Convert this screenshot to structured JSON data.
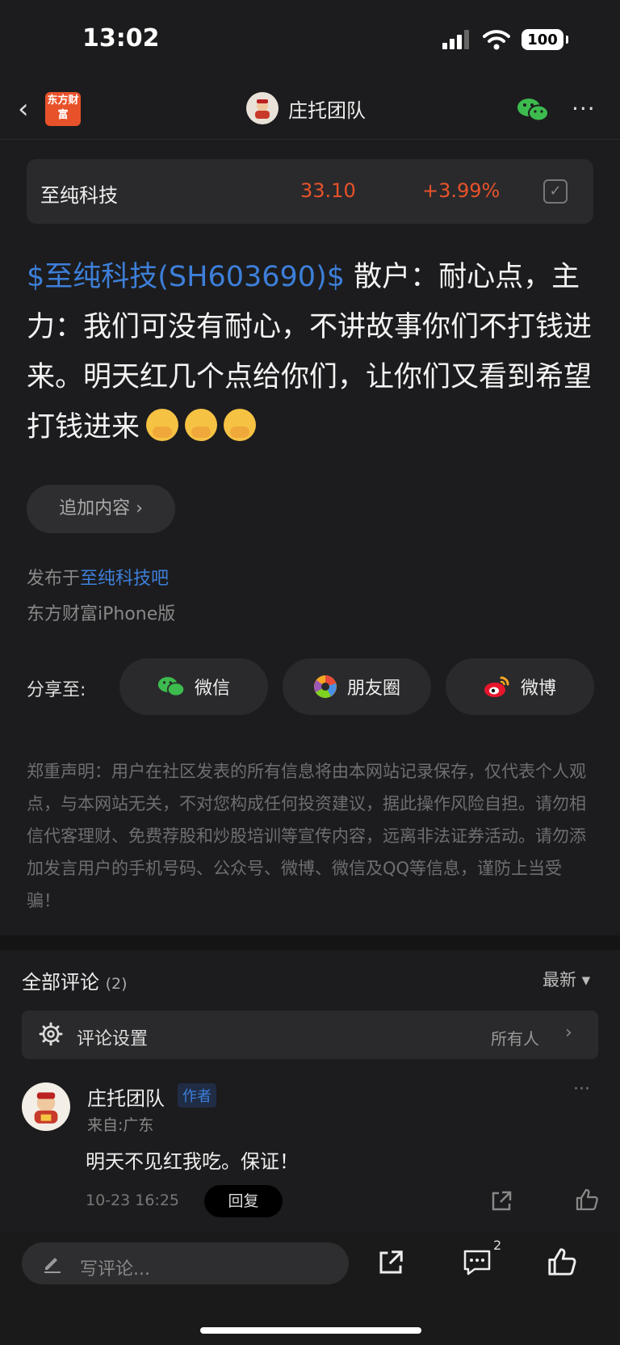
{
  "status_bar": {
    "time": "13:02",
    "battery": "100"
  },
  "nav": {
    "logo_text": "东方财富",
    "title": "庄托团队"
  },
  "stock": {
    "name": "至纯科技",
    "price": "33.10",
    "change": "+3.99%"
  },
  "post": {
    "tag": "$至纯科技(SH603690)$",
    "body": " 散户：耐心点，主力：我们可没有耐心，不讲故事你们不打钱进来。明天红几个点给你们，让你们又看到希望打钱进来"
  },
  "add_content": "追加内容 ›",
  "meta": {
    "published_prefix": "发布于",
    "forum": "至纯科技吧",
    "client": "东方财富iPhone版"
  },
  "share": {
    "label": "分享至:",
    "wechat": "微信",
    "moments": "朋友圈",
    "weibo": "微博"
  },
  "disclaimer": "郑重声明：用户在社区发表的所有信息将由本网站记录保存，仅代表个人观点，与本网站无关，不对您构成任何投资建议，据此操作风险自担。请勿相信代客理财、免费荐股和炒股培训等宣传内容，远离非法证券活动。请勿添加发言用户的手机号码、公众号、微博、微信及QQ等信息，谨防上当受骗！",
  "comments": {
    "title": "全部评论",
    "count": "(2)",
    "sort": "最新 ▾",
    "settings_label": "评论设置",
    "settings_value": "所有人",
    "items": [
      {
        "name": "庄托团队",
        "badge": "作者",
        "from": "来自:广东",
        "text": "明天不见红我吃。保证！",
        "time": "10-23 16:25",
        "reply": "回复"
      }
    ]
  },
  "bottom": {
    "write_placeholder": "写评论...",
    "comment_count": "2"
  },
  "colors": {
    "accent_red": "#e8522a",
    "link_blue": "#3d7fd9",
    "background": "#1c1c1e"
  }
}
